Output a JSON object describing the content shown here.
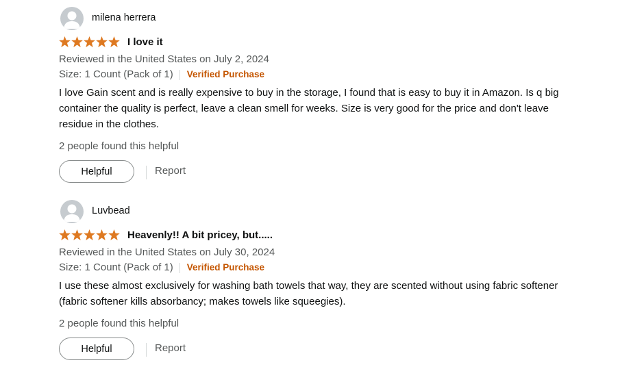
{
  "colors": {
    "star": "#de7921",
    "verified": "#c45500",
    "muted": "#565959",
    "avatar": "#c6cbcf"
  },
  "reviews": [
    {
      "reviewer": "milena herrera",
      "rating": 5,
      "title": "I love it",
      "meta": "Reviewed in the United States on July 2, 2024",
      "size": "Size: 1 Count (Pack of 1)",
      "verified": "Verified Purchase",
      "body": "I love Gain scent and is really expensive to buy in the storage, I found that is easy to buy it in Amazon. Is q big container the quality is perfect, leave a clean smell for weeks. Size is very good for the price and don't leave residue in the clothes.",
      "helpful_count": "2 people found this helpful",
      "helpful_label": "Helpful",
      "report_label": "Report"
    },
    {
      "reviewer": "Luvbead",
      "rating": 5,
      "title": "Heavenly!! A bit pricey, but.....",
      "meta": "Reviewed in the United States on July 30, 2024",
      "size": "Size: 1 Count (Pack of 1)",
      "verified": "Verified Purchase",
      "body": "I use these almost exclusively for washing bath towels that way, they are scented without using fabric softener (fabric softener kills absorbancy; makes towels like squeegies).",
      "helpful_count": "2 people found this helpful",
      "helpful_label": "Helpful",
      "report_label": "Report"
    }
  ]
}
